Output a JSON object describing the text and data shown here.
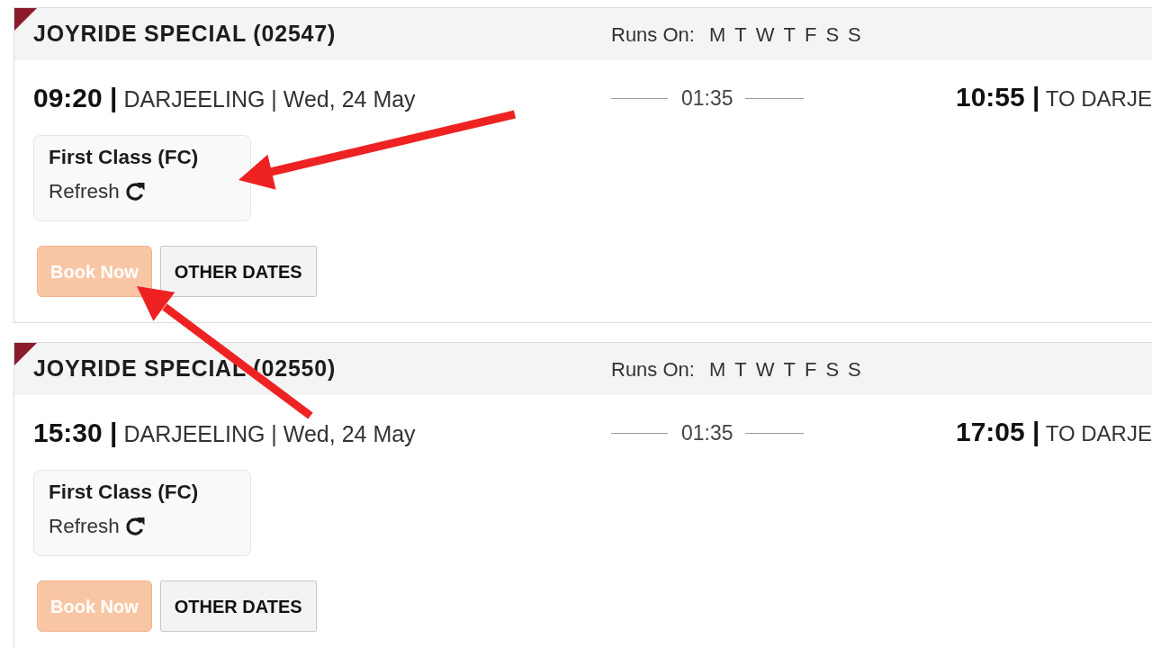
{
  "trains": [
    {
      "name": "JOYRIDE SPECIAL (02547)",
      "runs_on": {
        "label": "Runs On:",
        "days": [
          "M",
          "T",
          "W",
          "T",
          "F",
          "S",
          "S"
        ]
      },
      "departure": "**09:20 |** DARJEELING | Wed, 24 May",
      "duration": "01:35",
      "arrival": "**10:55 |** TO DARJE",
      "fare_classes": [
        {
          "name": "First Class (FC)",
          "action": "Refresh"
        }
      ],
      "buttons": [
        {
          "kind": "book",
          "label": "Book Now",
          "disabled": true
        },
        {
          "kind": "other",
          "label": "OTHER DATES",
          "disabled": false
        }
      ]
    },
    {
      "name": "JOYRIDE SPECIAL (02550)",
      "runs_on": {
        "label": "Runs On:",
        "days": [
          "M",
          "T",
          "W",
          "T",
          "F",
          "S",
          "S"
        ]
      },
      "departure": "**15:30 |** DARJEELING | Wed, 24 May",
      "duration": "01:35",
      "arrival": "**17:05 |** TO DARJE",
      "fare_classes": [
        {
          "name": "First Class (FC)",
          "action": "Refresh"
        }
      ],
      "buttons": [
        {
          "kind": "book",
          "label": "Book Now",
          "disabled": true
        },
        {
          "kind": "other",
          "label": "OTHER DATES",
          "disabled": false
        }
      ]
    }
  ],
  "annotations": [
    {
      "kind": "arrow"
    },
    {
      "kind": "arrow"
    }
  ]
}
